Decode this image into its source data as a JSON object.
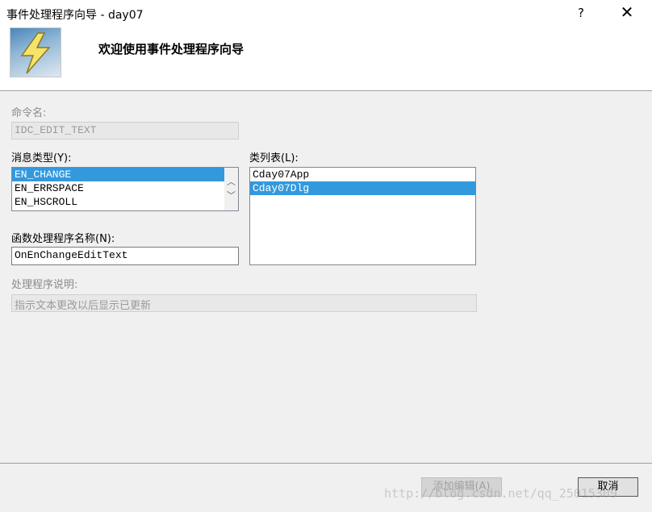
{
  "window": {
    "title": "事件处理程序向导 - day07",
    "help_glyph": "?",
    "close_glyph": "✕"
  },
  "header": {
    "title": "欢迎使用事件处理程序向导"
  },
  "command_name": {
    "label": "命令名:",
    "value": "IDC_EDIT_TEXT"
  },
  "message_type": {
    "label": "消息类型(Y):",
    "items": [
      "EN_CHANGE",
      "EN_ERRSPACE",
      "EN_HSCROLL"
    ],
    "selected": "EN_CHANGE"
  },
  "class_list": {
    "label": "类列表(L):",
    "items": [
      "Cday07App",
      "Cday07Dlg"
    ],
    "selected": "Cday07Dlg"
  },
  "function_name": {
    "label": "函数处理程序名称(N):",
    "value": "OnEnChangeEditText"
  },
  "handler_description": {
    "label": "处理程序说明:",
    "value": "指示文本更改以后显示已更新"
  },
  "buttons": {
    "add_edit": "添加编辑(A)",
    "cancel": "取消"
  },
  "watermark": "http://blog.csdn.net/qq_25015309",
  "colors": {
    "selection": "#3399dd",
    "dialog_bg": "#f0f0f0"
  }
}
